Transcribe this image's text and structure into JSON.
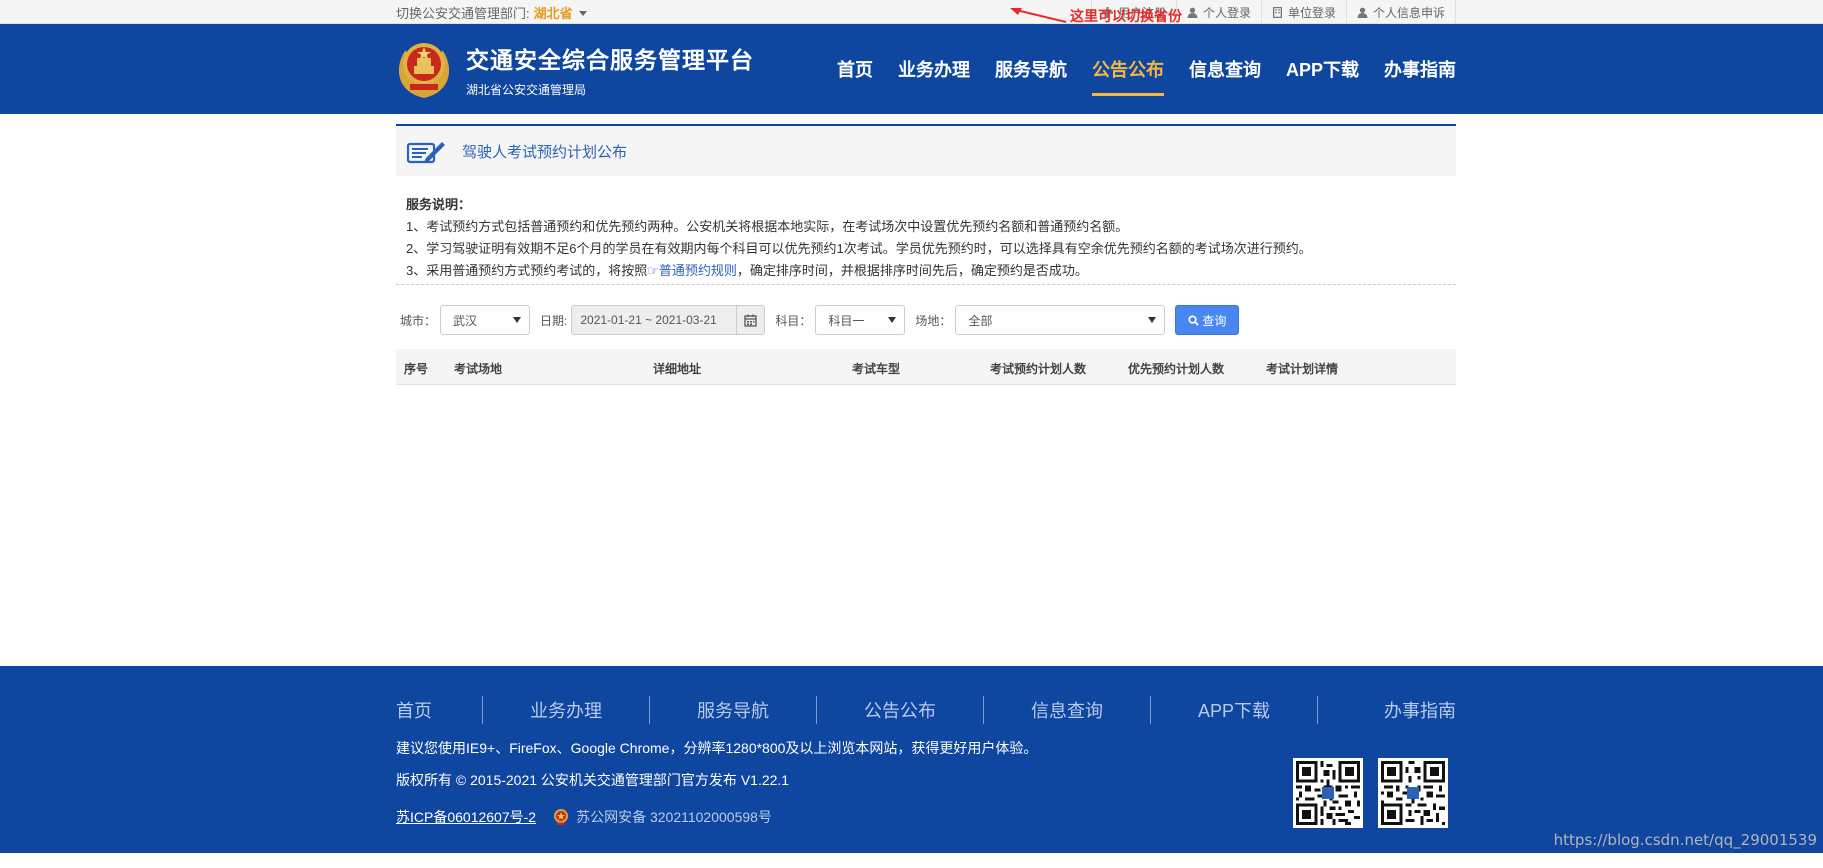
{
  "topbar": {
    "switch_label": "切换公安交通管理部门:",
    "province": "湖北省",
    "annotation": "这里可以切换省份",
    "links": [
      {
        "label": "用户注册",
        "icon": "plus-icon"
      },
      {
        "label": "个人登录",
        "icon": "user-icon"
      },
      {
        "label": "单位登录",
        "icon": "building-icon"
      },
      {
        "label": "个人信息申诉",
        "icon": "user-icon"
      }
    ]
  },
  "header": {
    "title": "交通安全综合服务管理平台",
    "subtitle": "湖北省公安交通管理局",
    "nav": [
      "首页",
      "业务办理",
      "服务导航",
      "公告公布",
      "信息查询",
      "APP下载",
      "办事指南"
    ],
    "active_nav": "公告公布"
  },
  "page": {
    "title": "驾驶人考试预约计划公布",
    "desc_heading": "服务说明：",
    "desc_1": "1、考试预约方式包括普通预约和优先预约两种。公安机关将根据本地实际，在考试场次中设置优先预约名额和普通预约名额。",
    "desc_2": "2、学习驾驶证明有效期不足6个月的学员在有效期内每个科目可以优先预约1次考试。学员优先预约时，可以选择具有空余优先预约名额的考试场次进行预约。",
    "desc_3_pre": "3、采用普通预约方式预约考试的，将按照",
    "desc_3_link": "☞普通预约规则",
    "desc_3_post": "，确定排序时间，并根据排序时间先后，确定预约是否成功。"
  },
  "filters": {
    "city_label": "城市：",
    "city_value": "武汉",
    "date_label": "日期:",
    "date_value": "2021-01-21 ~ 2021-03-21",
    "subject_label": "科目：",
    "subject_value": "科目一",
    "site_label": "场地：",
    "site_value": "全部",
    "query_button": "查询"
  },
  "table": {
    "headers": [
      "序号",
      "考试场地",
      "详细地址",
      "考试车型",
      "考试预约计划人数",
      "优先预约计划人数",
      "考试计划详情"
    ],
    "rows": []
  },
  "footer": {
    "nav": [
      "首页",
      "业务办理",
      "服务导航",
      "公告公布",
      "信息查询",
      "APP下载",
      "办事指南"
    ],
    "browser_note": "建议您使用IE9+、FireFox、Google Chrome，分辨率1280*800及以上浏览本网站，获得更好用户体验。",
    "copyright": "版权所有 © 2015-2021 公安机关交通管理部门官方发布 V1.22.1",
    "icp": "苏ICP备06012607号-2",
    "police_record": "苏公网安备 32021102000598号"
  },
  "watermark": "https://blog.csdn.net/qq_29001539",
  "colors": {
    "header_blue": "#0f46a0",
    "active_gold": "#f5b642",
    "link_blue": "#2a62b8",
    "query_button": "#4a86f0",
    "annotation_red": "#e62a2a"
  }
}
